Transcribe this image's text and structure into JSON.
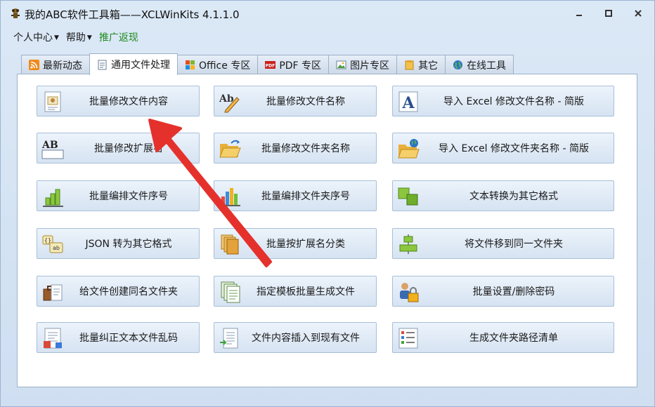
{
  "window": {
    "title": "我的ABC软件工具箱——XCLWinKits  4.1.1.0",
    "controls": [
      "minimize",
      "restore",
      "close"
    ]
  },
  "menu": {
    "personal": "个人中心",
    "help": "帮助",
    "promo": "推广返现"
  },
  "tabs": [
    {
      "label": "最新动态",
      "icon": "rss-icon"
    },
    {
      "label": "通用文件处理",
      "icon": "document-icon",
      "active": true
    },
    {
      "label": "Office 专区",
      "icon": "office-icon"
    },
    {
      "label": "PDF 专区",
      "icon": "pdf-icon"
    },
    {
      "label": "图片专区",
      "icon": "image-icon"
    },
    {
      "label": "其它",
      "icon": "folder-icon"
    },
    {
      "label": "在线工具",
      "icon": "globe-icon"
    }
  ],
  "buttons": [
    {
      "label": "批量修改文件内容",
      "icon": "file-content-icon"
    },
    {
      "label": "批量修改文件名称",
      "icon": "rename-pencil-icon"
    },
    {
      "label": "导入 Excel 修改文件名称 - 简版",
      "icon": "letter-a-icon"
    },
    {
      "label": "批量修改扩展名",
      "icon": "ab-extension-icon"
    },
    {
      "label": "批量修改文件夹名称",
      "icon": "folder-open-icon"
    },
    {
      "label": "导入 Excel 修改文件夹名称 - 简版",
      "icon": "folder-globe-icon"
    },
    {
      "label": "批量编排文件序号",
      "icon": "bar-chart-green-icon"
    },
    {
      "label": "批量编排文件夹序号",
      "icon": "bar-chart-color-icon"
    },
    {
      "label": "文本转换为其它格式",
      "icon": "convert-squares-icon"
    },
    {
      "label": "JSON 转为其它格式",
      "icon": "json-icon"
    },
    {
      "label": "批量按扩展名分类",
      "icon": "stack-folders-icon"
    },
    {
      "label": "将文件移到同一文件夹",
      "icon": "align-center-icon"
    },
    {
      "label": "给文件创建同名文件夹",
      "icon": "briefcase-file-icon"
    },
    {
      "label": "指定模板批量生成文件",
      "icon": "template-stack-icon"
    },
    {
      "label": "批量设置/删除密码",
      "icon": "user-lock-icon"
    },
    {
      "label": "批量纠正文本文件乱码",
      "icon": "text-file-fix-icon"
    },
    {
      "label": "文件内容插入到现有文件",
      "icon": "insert-file-icon"
    },
    {
      "label": "生成文件夹路径清单",
      "icon": "list-icon"
    }
  ],
  "colors": {
    "accent_red": "#e5312c",
    "promo_green": "#1d8a1d",
    "button_border": "#a9bfd9"
  }
}
